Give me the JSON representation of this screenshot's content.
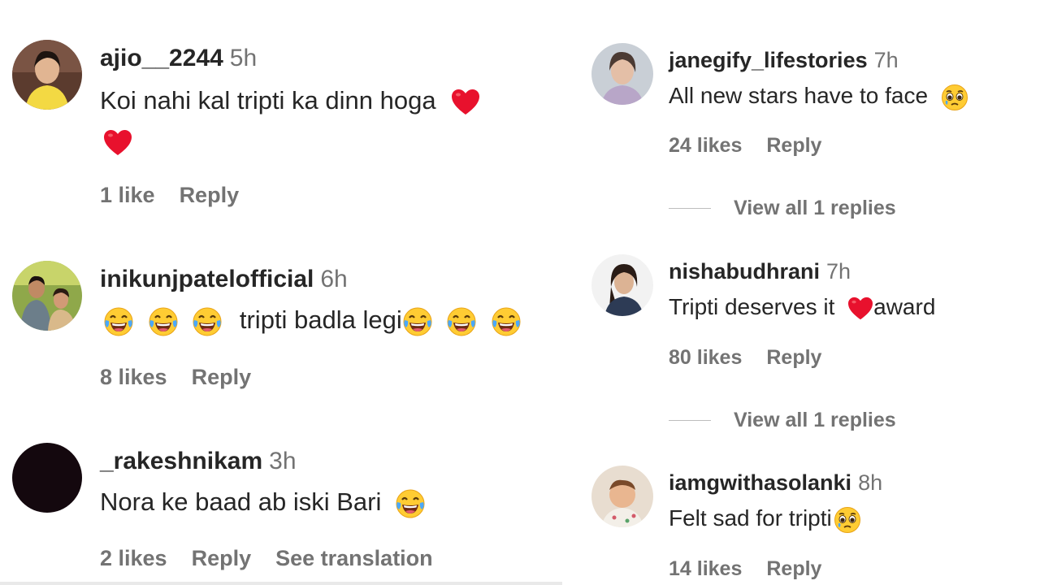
{
  "left_comments": [
    {
      "username": "ajio__2244",
      "time": "5h",
      "text": "Koi nahi kal tripti ka dinn hoga",
      "likes": "1 like",
      "reply": "Reply"
    },
    {
      "username": "inikunjpatelofficial",
      "time": "6h",
      "text": "tripti badla legi",
      "likes": "8 likes",
      "reply": "Reply"
    },
    {
      "username": "_rakeshnikam",
      "time": "3h",
      "text": "Nora ke baad ab iski Bari",
      "likes": "2 likes",
      "reply": "Reply",
      "translation": "See translation"
    }
  ],
  "right_comments": [
    {
      "username": "janegify_lifestories",
      "time": "7h",
      "text": "All new stars have to face",
      "likes": "24 likes",
      "reply": "Reply",
      "view_replies": "View all 1 replies"
    },
    {
      "username": "nishabudhrani",
      "time": "7h",
      "text_before": "Tripti deserves it",
      "text_after": "award",
      "likes": "80 likes",
      "reply": "Reply",
      "view_replies": "View all 1 replies"
    },
    {
      "username": "iamgwithasolanki",
      "time": "8h",
      "text": "Felt sad for tripti",
      "likes": "14 likes",
      "reply": "Reply"
    }
  ],
  "icons": {
    "heart": "red-heart-emoji",
    "laugh": "tears-of-joy-emoji",
    "cry": "pleading-face-emoji"
  },
  "colors": {
    "text": "#262626",
    "secondary": "#737373",
    "heart": "#e8112d"
  }
}
